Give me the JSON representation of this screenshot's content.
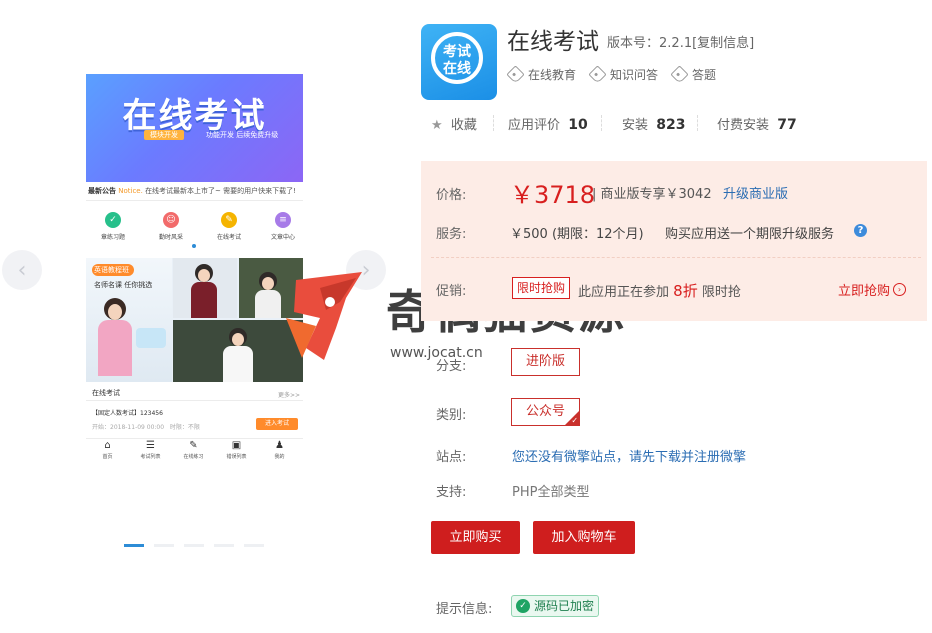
{
  "gallery": {
    "prev_icon": "chevron-left-icon",
    "next_icon": "chevron-right-icon",
    "screenshot": {
      "banner_title": "在线考试",
      "banner_badge": "模块开发",
      "banner_badge_tail": "功能开发 后续免费升级",
      "notice_label": "最新公告",
      "notice_highlight": "Notice.",
      "notice_text": "在线考试最新本上市了~ 需要的用户快来下载了!",
      "quick_entries": [
        {
          "label": "章练习题",
          "color": "#27c08b",
          "glyph": "✓"
        },
        {
          "label": "勤时风采",
          "color": "#f26b6b",
          "glyph": "☺"
        },
        {
          "label": "在线考试",
          "color": "#f5b400",
          "glyph": "✎"
        },
        {
          "label": "文章中心",
          "color": "#a77be8",
          "glyph": "≡"
        }
      ],
      "mid_badge": "英语教程班",
      "mid_text": "名师名课 任你挑选",
      "exam_section_title": "在线考试",
      "exam_more": "更多>>",
      "exam_item": "【固定人数考试】123456",
      "exam_meta_left": "开始：2018-11-09 00:00",
      "exam_meta_right": "时限：不限",
      "exam_button": "进入考试",
      "tabs": [
        {
          "label": "首页",
          "icon": "home-icon",
          "glyph": "⌂"
        },
        {
          "label": "考试列表",
          "icon": "list-icon",
          "glyph": "☰"
        },
        {
          "label": "在线练习",
          "icon": "edit-icon",
          "glyph": "✎"
        },
        {
          "label": "错误列表",
          "icon": "briefcase-icon",
          "glyph": "▣"
        },
        {
          "label": "我的",
          "icon": "user-icon",
          "glyph": "♟"
        }
      ]
    },
    "slide_count": 5,
    "active_slide": 1
  },
  "app": {
    "icon_text_line1": "考试",
    "icon_text_line2": "在线",
    "title": "在线考试",
    "version_label": "版本号：",
    "version": "2.2.1",
    "copy_label": "[复制信息]",
    "tags": [
      "在线教育",
      "知识问答",
      "答题"
    ]
  },
  "stats": {
    "favorite_label": "收藏",
    "rating_label": "应用评价",
    "rating_value": "10",
    "install_label": "安装",
    "install_value": "823",
    "paid_install_label": "付费安装",
    "paid_install_value": "77"
  },
  "pricing": {
    "price_label": "价格:",
    "price": "￥3718",
    "commercial_note": "| 商业版专享￥3042",
    "upgrade_link": "升级商业版",
    "service_label": "服务:",
    "service_value": "￥500 (期限：12个月)",
    "service_note": "购买应用送一个期限升级服务",
    "promo_label": "促销:",
    "promo_badge": "限时抢购",
    "promo_text_prefix": "此应用正在参加",
    "promo_discount": "8折",
    "promo_text_suffix": "限时抢",
    "promo_link": "立即抢购"
  },
  "options": {
    "branch_label": "分支:",
    "branch_value": "进阶版",
    "category_label": "类别:",
    "category_value": "公众号",
    "site_label": "站点:",
    "site_link": "您还没有微擎站点，请先下载并注册微擎",
    "support_label": "支持:",
    "support_value": "PHP全部类型"
  },
  "actions": {
    "buy_now": "立即购买",
    "add_to_cart": "加入购物车"
  },
  "hint": {
    "label": "提示信息:",
    "badge": "源码已加密"
  },
  "watermark": {
    "text": "奇偶猫资源",
    "url": "www.jocat.cn"
  },
  "colors": {
    "accent_red": "#cf1e1e",
    "link_blue": "#2b6db3",
    "price_box_bg": "#fdece6",
    "indicator_active": "#2d8cd6"
  }
}
